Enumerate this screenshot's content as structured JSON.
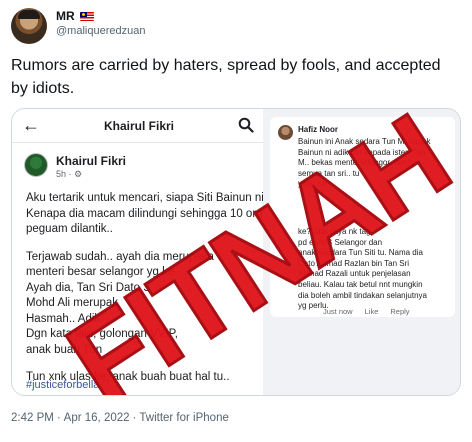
{
  "author": {
    "display_name": "MR",
    "handle": "@maliqueredzuan",
    "avatar_icon": "avatar-photo",
    "flag_icon": "malaysia-flag-icon"
  },
  "tweet": {
    "text": "Rumors are carried by haters, spread by fools, and accepted by idiots."
  },
  "media": {
    "facebook": {
      "header_title": "Khairul Fikri",
      "back_icon": "arrow-left-icon",
      "search_icon": "search-icon",
      "post_author": "Khairul Fikri",
      "post_meta": "5h · ⚙",
      "post_lines": [
        "Aku tertarik untuk mencari, siapa Siti Bainun ni??",
        "Kenapa dia macam dilindungi sehingga 10 org",
        "peguam dilantik..",
        "Terjawab sudah.. ayah dia merupaka",
        "menteri besar selangor yg ke",
        "Ayah dia, Tan Sri Dato S",
        "Mohd Ali merupak",
        "Hasmah.. Adik",
        "Dgn kata lain,          golongan VVIP,",
        "anak buah Tun"
      ],
      "post_last_line": "Tun xnk ulas ke, anak buah buat hal tu..",
      "hashtag": "#justiceforbella"
    },
    "comment": {
      "name": "Hafiz Noor",
      "lines_top": [
        "Bainun ini Anak sedara Tun M, bapak",
        "Bainun ni adik ber      kepada isteri Tun",
        "M.. bekas mente      selangor..family",
        "semua              tan sri.. tu",
        "yang se"
      ],
      "lines_bottom": [
        "                 ke? Sbb saya nk tag",
        "                pd ex-MB Selangor dan",
        "anak saudara Tun Siti tu. Nama dia",
        "Dato Ahmad Razlan bin Tan Sri",
        "Ahmad Razali untuk penjelasan",
        "beliau. Kalau tak betul nnt mungkin",
        "dia boleh ambil tindakan selanjutnya",
        "yg perlu."
      ],
      "actions": [
        "Just now",
        "Like",
        "Reply"
      ]
    },
    "stamp_text": "FITNAH"
  },
  "footer": {
    "time": "2:42 PM",
    "separator1": "·",
    "date": "Apr 16, 2022",
    "separator2": "·",
    "source": "Twitter for iPhone"
  },
  "colors": {
    "stamp": "#e0141c",
    "link": "#385898",
    "secondary_text": "#536471"
  }
}
